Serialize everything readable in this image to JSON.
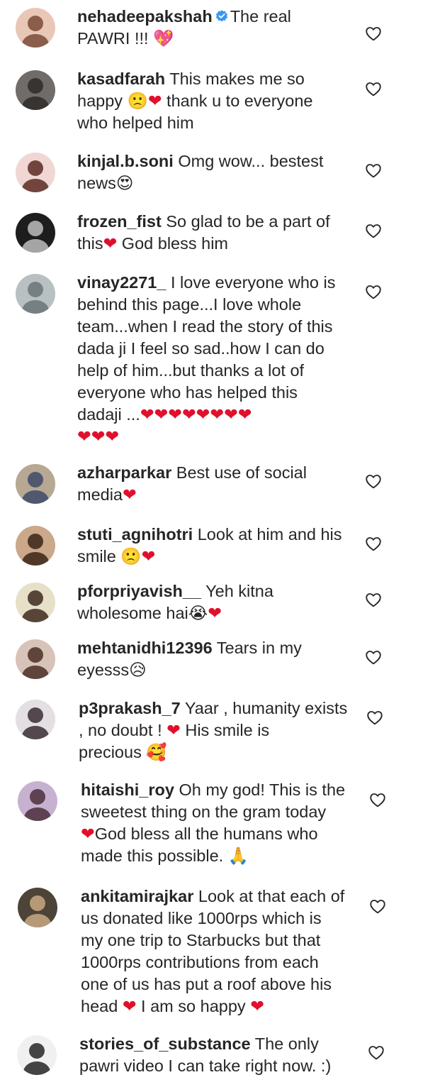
{
  "comments": [
    {
      "username": "nehadeepakshah",
      "verified": true,
      "text": "The real\nPAWRI !!! 💖",
      "avatar_bg": "#e9c7b6",
      "avatar_fg": "#7a4a38"
    },
    {
      "username": "kasadfarah",
      "verified": false,
      "text": "This makes me so\nhappy 🙁❤ thank u to everyone\nwho helped him",
      "avatar_bg": "#6f6c6a",
      "avatar_fg": "#2e2a28"
    },
    {
      "username": "kinjal.b.soni",
      "verified": false,
      "text": "Omg wow... bestest\nnews😍",
      "avatar_bg": "#f1d7d3",
      "avatar_fg": "#5a2c22"
    },
    {
      "username": "frozen_fist",
      "verified": false,
      "text": "So glad to be a part of\nthis❤ God bless him",
      "avatar_bg": "#1d1d1d",
      "avatar_fg": "#bdbdbd"
    },
    {
      "username": "vinay2271_",
      "verified": false,
      "text": "I love everyone who is\nbehind this page...I love whole\nteam...when I read the story of this\ndada ji I feel so sad..how I can do\nhelp of him...but thanks a lot of\neveryone who has helped this\ndadaji ...❤❤❤❤❤❤❤❤\n❤❤❤",
      "avatar_bg": "#b9c0c2",
      "avatar_fg": "#6a7478"
    },
    {
      "username": "azharparkar",
      "verified": false,
      "text": "Best use of social\nmedia❤",
      "avatar_bg": "#b6a892",
      "avatar_fg": "#3e4a6a"
    },
    {
      "username": "stuti_agnihotri",
      "verified": false,
      "text": "Look at him and his\nsmile 🙁❤",
      "avatar_bg": "#caa889",
      "avatar_fg": "#3b2419"
    },
    {
      "username": "pforpriyavish__",
      "verified": false,
      "text": "Yeh kitna\nwholesome hai😭❤",
      "avatar_bg": "#e7e0c8",
      "avatar_fg": "#3d2a1e"
    },
    {
      "username": "mehtanidhi12396",
      "verified": false,
      "text": "Tears in my\neyesss😥",
      "avatar_bg": "#d8c3b8",
      "avatar_fg": "#4a2f25"
    },
    {
      "username": "p3prakash_7",
      "verified": false,
      "text": "Yaar , humanity exists\n, no doubt ! ❤ His smile is\nprecious 🥰",
      "avatar_bg": "#e3dfe3",
      "avatar_fg": "#3a2e34"
    },
    {
      "username": "hitaishi_roy",
      "verified": false,
      "text": "Oh my god! This is the\nsweetest thing on the gram today\n❤God bless all the humans who\nmade this possible. 🙏",
      "avatar_bg": "#c7b1d0",
      "avatar_fg": "#4b2f3c"
    },
    {
      "username": "ankitamirajkar",
      "verified": false,
      "text": "Look at that each of\nus donated like 1000rps which is\nmy one trip to Starbucks but that\n1000rps contributions from each\none of us has put a roof above his\nhead ❤ I am so happy ❤",
      "avatar_bg": "#4d4337",
      "avatar_fg": "#c9a983"
    },
    {
      "username": "stories_of_substance",
      "verified": false,
      "text": "The only\npawri video I can take right now. :)",
      "avatar_bg": "#f0f0f0",
      "avatar_fg": "#262626"
    }
  ],
  "icons": {
    "like": "heart-outline-icon",
    "verified": "verified-badge-icon"
  },
  "colors": {
    "text": "#262626",
    "verified_badge": "#3897f0",
    "heart_emoji": "#e0102c",
    "like_icon": "#262626"
  }
}
